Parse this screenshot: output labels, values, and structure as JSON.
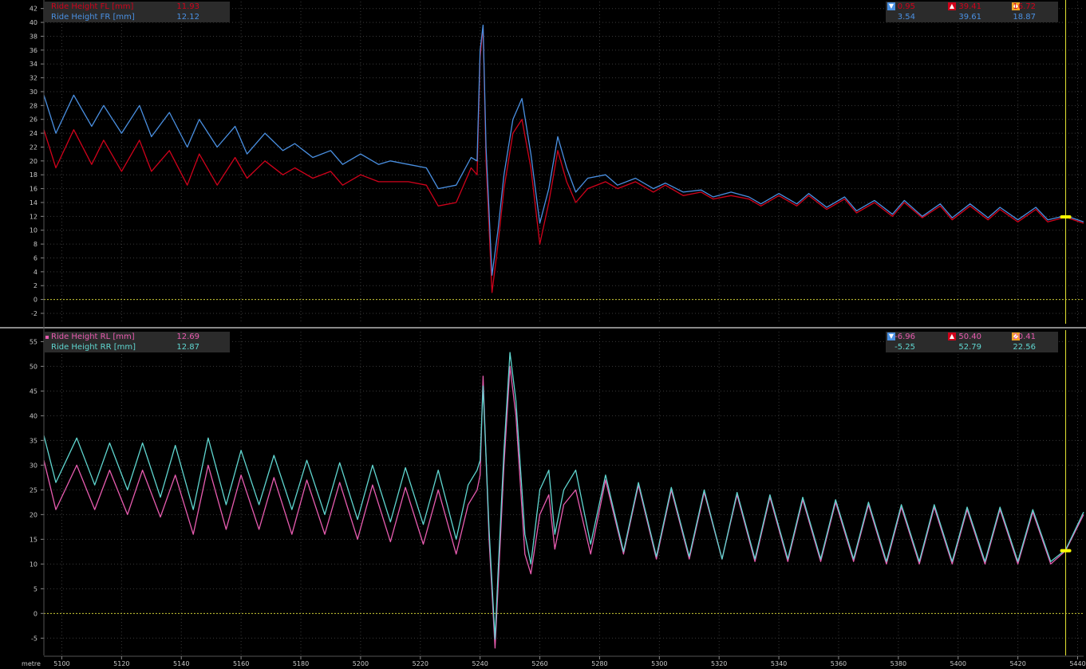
{
  "colors": {
    "background": "#000000",
    "grid": "#3a3a3a",
    "zero_line": "#c8c832",
    "cursor": "#e6e632",
    "cursor_marker": "#ffff00",
    "FL": "#d0021b",
    "FR": "#4a90e2",
    "RL": "#e85cb0",
    "RR": "#5fd6d0",
    "axis_text": "#c8c8c8",
    "min_icon": "#4a90e2",
    "max_icon": "#d0021b",
    "avg_icon": "#f5a623"
  },
  "icons": {
    "min": "triangle-down-icon",
    "max": "triangle-up-icon",
    "avg": "diamond-icon"
  },
  "chart_data": [
    {
      "type": "line",
      "title": "",
      "xlabel": "metre",
      "ylabel": "",
      "xlim": [
        5094,
        5442
      ],
      "ylim": [
        -3.5,
        43
      ],
      "yticks": [
        -2,
        0,
        2,
        4,
        6,
        8,
        10,
        12,
        14,
        16,
        18,
        20,
        22,
        24,
        26,
        28,
        30,
        32,
        34,
        36,
        38,
        40,
        42
      ],
      "grid": true,
      "legend": "top-left",
      "cursor_x": 5436,
      "series": [
        {
          "name": "Ride Height FL [mm]",
          "key": "FL",
          "cursor_value": "11.93",
          "min": "0.95",
          "max": "39.41",
          "avg": "16.72",
          "x": [
            5094,
            5098,
            5104,
            5110,
            5114,
            5120,
            5126,
            5130,
            5136,
            5142,
            5146,
            5152,
            5158,
            5162,
            5168,
            5174,
            5178,
            5184,
            5190,
            5194,
            5200,
            5206,
            5210,
            5216,
            5222,
            5226,
            5232,
            5237,
            5239,
            5240,
            5241,
            5242,
            5244,
            5246,
            5248,
            5251,
            5254,
            5257,
            5260,
            5263,
            5266,
            5269,
            5272,
            5276,
            5282,
            5286,
            5292,
            5298,
            5302,
            5308,
            5314,
            5318,
            5324,
            5330,
            5334,
            5340,
            5346,
            5350,
            5356,
            5362,
            5366,
            5372,
            5378,
            5382,
            5388,
            5394,
            5398,
            5404,
            5410,
            5414,
            5420,
            5426,
            5430,
            5436,
            5442
          ],
          "y": [
            24.5,
            19,
            24.5,
            19.5,
            23,
            18.5,
            23,
            18.5,
            21.5,
            16.5,
            21,
            16.5,
            20.5,
            17.5,
            20,
            18,
            19,
            17.5,
            18.5,
            16.5,
            18,
            17,
            17,
            17,
            16.5,
            13.5,
            14,
            19,
            18,
            35,
            39.4,
            20,
            1,
            8,
            16,
            24,
            26,
            19,
            8,
            14,
            21.5,
            17,
            14,
            16,
            17,
            16,
            17,
            15.5,
            16.5,
            15,
            15.5,
            14.5,
            15,
            14.5,
            13.5,
            15,
            13.5,
            15,
            13,
            14.5,
            12.5,
            14,
            12,
            14,
            11.8,
            13.5,
            11.5,
            13.5,
            11.5,
            13,
            11.2,
            13,
            11.2,
            11.9,
            11
          ]
        },
        {
          "name": "Ride Height FR [mm]",
          "key": "FR",
          "cursor_value": "12.12",
          "min": "3.54",
          "max": "39.61",
          "avg": "18.87",
          "x": [
            5094,
            5098,
            5104,
            5110,
            5114,
            5120,
            5126,
            5130,
            5136,
            5142,
            5146,
            5152,
            5158,
            5162,
            5168,
            5174,
            5178,
            5184,
            5190,
            5194,
            5200,
            5206,
            5210,
            5216,
            5222,
            5226,
            5232,
            5237,
            5239,
            5240,
            5241,
            5242,
            5244,
            5246,
            5248,
            5251,
            5254,
            5257,
            5260,
            5263,
            5266,
            5269,
            5272,
            5276,
            5282,
            5286,
            5292,
            5298,
            5302,
            5308,
            5314,
            5318,
            5324,
            5330,
            5334,
            5340,
            5346,
            5350,
            5356,
            5362,
            5366,
            5372,
            5378,
            5382,
            5388,
            5394,
            5398,
            5404,
            5410,
            5414,
            5420,
            5426,
            5430,
            5436,
            5442
          ],
          "y": [
            29.5,
            24,
            29.5,
            25,
            28,
            24,
            28,
            23.5,
            27,
            22,
            26,
            22,
            25,
            21,
            24,
            21.5,
            22.5,
            20.5,
            21.5,
            19.5,
            21,
            19.5,
            20,
            19.5,
            19,
            16,
            16.5,
            20.5,
            20,
            36,
            39.6,
            22,
            3.5,
            10,
            18,
            26,
            29,
            21,
            11,
            16,
            23.5,
            19,
            15.5,
            17.5,
            18,
            16.5,
            17.5,
            16,
            16.8,
            15.5,
            15.8,
            14.8,
            15.5,
            14.8,
            13.8,
            15.3,
            13.8,
            15.3,
            13.3,
            14.8,
            12.8,
            14.3,
            12.3,
            14.3,
            12,
            13.8,
            11.8,
            13.8,
            11.8,
            13.3,
            11.5,
            13.3,
            11.5,
            12.1,
            11.2
          ]
        }
      ]
    },
    {
      "type": "line",
      "title": "",
      "xlabel": "metre",
      "ylabel": "",
      "xlim": [
        5094,
        5442
      ],
      "ylim": [
        -8.5,
        57
      ],
      "yticks": [
        -5,
        0,
        5,
        10,
        15,
        20,
        25,
        30,
        35,
        40,
        45,
        50,
        55
      ],
      "xticks": [
        5100,
        5120,
        5140,
        5160,
        5180,
        5200,
        5220,
        5240,
        5260,
        5280,
        5300,
        5320,
        5340,
        5360,
        5380,
        5400,
        5420,
        5440
      ],
      "grid": true,
      "legend": "top-left",
      "cursor_x": 5436,
      "series": [
        {
          "name": "Ride Height RL [mm]",
          "key": "RL",
          "cursor_value": "12.69",
          "min": "-6.96",
          "max": "50.40",
          "avg": "20.41",
          "x": [
            5094,
            5098,
            5105,
            5111,
            5116,
            5122,
            5127,
            5133,
            5138,
            5144,
            5149,
            5155,
            5160,
            5166,
            5171,
            5177,
            5182,
            5188,
            5193,
            5199,
            5204,
            5210,
            5215,
            5221,
            5226,
            5232,
            5236,
            5239,
            5240,
            5241,
            5243,
            5245,
            5246,
            5248,
            5250,
            5252,
            5255,
            5257,
            5260,
            5263,
            5265,
            5268,
            5272,
            5277,
            5282,
            5288,
            5293,
            5299,
            5304,
            5310,
            5315,
            5321,
            5326,
            5332,
            5337,
            5343,
            5348,
            5354,
            5359,
            5365,
            5370,
            5376,
            5381,
            5387,
            5392,
            5398,
            5403,
            5409,
            5414,
            5420,
            5425,
            5431,
            5436,
            5442
          ],
          "y": [
            31,
            21,
            30,
            21,
            29,
            20,
            29,
            19.5,
            28,
            16,
            30,
            17,
            28,
            17,
            27.5,
            16,
            27,
            16,
            26.5,
            15,
            26,
            14.5,
            25.5,
            14,
            25,
            12,
            22,
            25,
            28,
            48,
            15,
            -7,
            5,
            30,
            50,
            40,
            12,
            8,
            20,
            24,
            13,
            22,
            25,
            12,
            27,
            12,
            26,
            11,
            25,
            11,
            24.5,
            11,
            24,
            10.5,
            23.5,
            10.5,
            23,
            10.5,
            22.5,
            10.5,
            22,
            10,
            21.5,
            10,
            21.5,
            10,
            21,
            10,
            21,
            10,
            20.5,
            10,
            12.7,
            20
          ]
        },
        {
          "name": "Ride Height RR [mm]",
          "key": "RR",
          "cursor_value": "12.87",
          "min": "-5.25",
          "max": "52.79",
          "avg": "22.56",
          "x": [
            5094,
            5098,
            5105,
            5111,
            5116,
            5122,
            5127,
            5133,
            5138,
            5144,
            5149,
            5155,
            5160,
            5166,
            5171,
            5177,
            5182,
            5188,
            5193,
            5199,
            5204,
            5210,
            5215,
            5221,
            5226,
            5232,
            5236,
            5239,
            5240,
            5241,
            5243,
            5245,
            5246,
            5248,
            5250,
            5252,
            5255,
            5257,
            5260,
            5263,
            5265,
            5268,
            5272,
            5277,
            5282,
            5288,
            5293,
            5299,
            5304,
            5310,
            5315,
            5321,
            5326,
            5332,
            5337,
            5343,
            5348,
            5354,
            5359,
            5365,
            5370,
            5376,
            5381,
            5387,
            5392,
            5398,
            5403,
            5409,
            5414,
            5420,
            5425,
            5431,
            5436,
            5442
          ],
          "y": [
            36,
            26.5,
            35.5,
            26,
            34.5,
            25,
            34.5,
            23.5,
            34,
            21,
            35.5,
            22,
            33,
            22,
            32,
            21,
            31,
            20,
            30.5,
            19,
            30,
            18.5,
            29.5,
            18,
            29,
            15,
            26,
            29,
            31,
            46,
            17,
            -5.2,
            8,
            33,
            52.8,
            43,
            16,
            10,
            25,
            29,
            16,
            25,
            29,
            14,
            28,
            12.5,
            26.5,
            11.5,
            25.5,
            11.5,
            25,
            11,
            24.5,
            11,
            24,
            11,
            23.5,
            11,
            23,
            11,
            22.5,
            10.5,
            22,
            10.5,
            22,
            10.5,
            21.5,
            10.5,
            21.5,
            10.5,
            21,
            10.5,
            12.9,
            20.5
          ]
        }
      ]
    }
  ]
}
